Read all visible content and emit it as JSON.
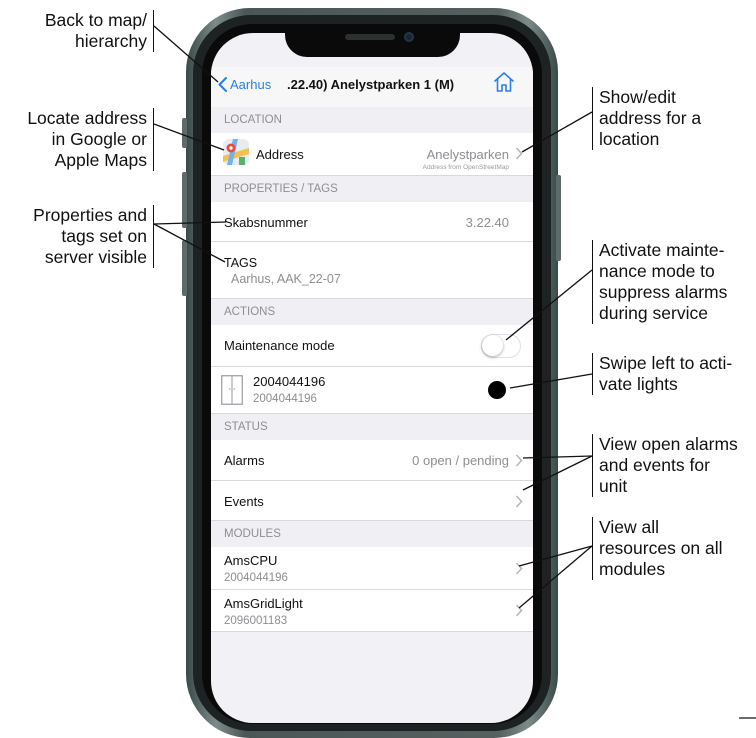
{
  "callouts": {
    "back_to_map": [
      "Back to map/",
      "hierarchy"
    ],
    "locate_address": [
      "Locate address",
      "in Google or",
      "Apple Maps"
    ],
    "properties_tags": [
      "Properties and",
      "tags set on",
      "server visible"
    ],
    "show_edit_address": [
      "Show/edit",
      "address for a",
      "location"
    ],
    "maintenance": [
      "Activate mainte-",
      "nance mode to",
      "suppress alarms",
      "during service"
    ],
    "swipe": [
      "Swipe left to acti-",
      "vate lights"
    ],
    "alarms_events": [
      "View open alarms",
      "and events for",
      "unit"
    ],
    "modules": [
      "View all",
      "resources on all",
      "modules"
    ]
  },
  "nav": {
    "back_label": "Aarhus",
    "title": ".22.40) Anelystparken 1 (M)"
  },
  "location": {
    "header": "LOCATION",
    "address_label": "Address",
    "address_value": "Anelystparken",
    "address_source": "Address from OpenStreetMap"
  },
  "properties": {
    "header": "PROPERTIES / TAGS",
    "skab_label": "Skabsnummer",
    "skab_value": "3.22.40",
    "tags_label": "TAGS",
    "tags_value": "Aarhus, AAK_22-07"
  },
  "actions": {
    "header": "ACTIONS",
    "maintenance_label": "Maintenance mode",
    "maintenance_on": false,
    "device_id": "2004044196",
    "device_sub": "2004044196"
  },
  "status": {
    "header": "STATUS",
    "alarms_label": "Alarms",
    "alarms_value": "0 open / pending",
    "events_label": "Events"
  },
  "modules": {
    "header": "MODULES",
    "items": [
      {
        "name": "AmsCPU",
        "id": "2004044196"
      },
      {
        "name": "AmsGridLight",
        "id": "2096001183"
      }
    ]
  },
  "colors": {
    "accent": "#2b7de9",
    "section_bg": "#efeff4",
    "secondary_text": "#8e8e93"
  }
}
